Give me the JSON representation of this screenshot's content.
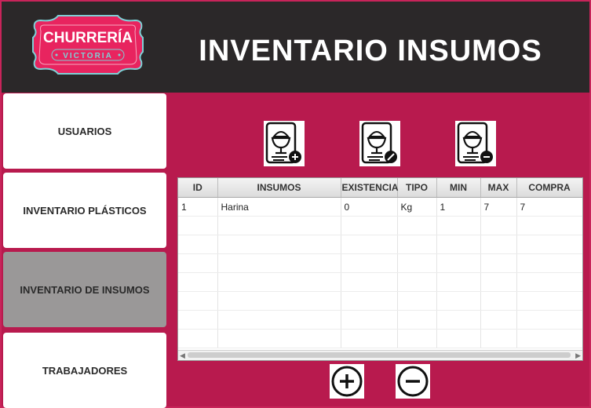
{
  "brand": {
    "name": "CHURRERÍA",
    "sub": "VICTORIA"
  },
  "header": {
    "title": "INVENTARIO INSUMOS"
  },
  "sidebar": {
    "items": [
      {
        "label": "USUARIOS"
      },
      {
        "label": "INVENTARIO PLÁSTICOS"
      },
      {
        "label": "INVENTARIO DE INSUMOS"
      },
      {
        "label": "TRABAJADORES"
      }
    ],
    "active_index": 2
  },
  "toolbar": {
    "icons": [
      "add-supply-icon",
      "edit-supply-icon",
      "remove-supply-icon"
    ]
  },
  "table": {
    "columns": [
      "ID",
      "INSUMOS",
      "EXISTENCIA",
      "TIPO",
      "MIN",
      "MAX",
      "COMPRA"
    ],
    "rows": [
      [
        "1",
        "Harina",
        "0",
        "Kg",
        "1",
        "7",
        "7"
      ]
    ]
  },
  "footer": {
    "icons": [
      "plus-circle-icon",
      "minus-circle-icon"
    ]
  },
  "colors": {
    "accent": "#b81a4e",
    "header_bg": "#2b2829",
    "active_nav": "#9a9898",
    "logo_pink": "#e8245f",
    "logo_teal": "#7ed1d6"
  }
}
